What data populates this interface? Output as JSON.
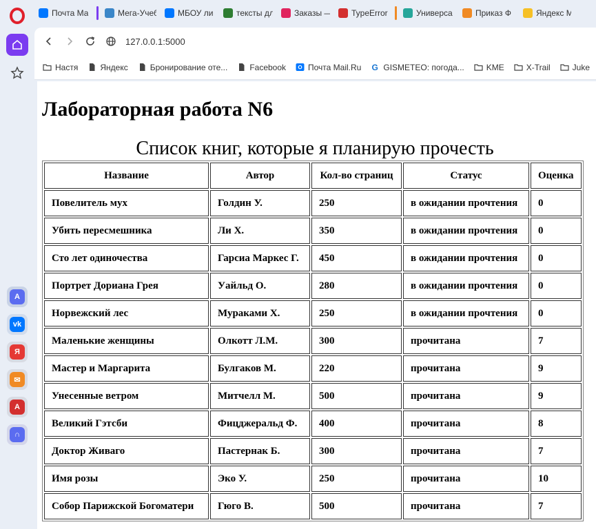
{
  "tabs": [
    {
      "title": "Почта Ма",
      "color": "#0077ff",
      "group": ""
    },
    {
      "title": "Мега-Учеб",
      "color": "#3a86c8",
      "group": "#7b3cf0"
    },
    {
      "title": "МБОУ ли",
      "color": "#0077ff",
      "group": ""
    },
    {
      "title": "тексты дл",
      "color": "#2e7d32",
      "group": ""
    },
    {
      "title": "Заказы —",
      "color": "#e0245e",
      "group": ""
    },
    {
      "title": "TypeError",
      "color": "#d32f2f",
      "group": ""
    },
    {
      "title": "Универса",
      "color": "#26a69a",
      "group": "#f08a24"
    },
    {
      "title": "Приказ Ф",
      "color": "#f08a24",
      "group": ""
    },
    {
      "title": "Яндекс М",
      "color": "#f6c026",
      "group": ""
    }
  ],
  "toolbar": {
    "back_icon": "back-arrow-icon",
    "forward_icon": "forward-arrow-icon",
    "reload_icon": "reload-icon",
    "url": "127.0.0.1:5000"
  },
  "bookmarks": [
    {
      "label": "Настя",
      "icon": "folder-icon"
    },
    {
      "label": "Яндекс",
      "icon": "page-icon"
    },
    {
      "label": "Бронирование оте...",
      "icon": "page-icon"
    },
    {
      "label": "Facebook",
      "icon": "page-icon"
    },
    {
      "label": "Почта Mail.Ru",
      "icon": "mail-icon"
    },
    {
      "label": "GISMETEO: погода...",
      "icon": "g-icon"
    },
    {
      "label": "KME",
      "icon": "folder-icon"
    },
    {
      "label": "X-Trail",
      "icon": "folder-icon"
    },
    {
      "label": "Juke",
      "icon": "folder-icon"
    }
  ],
  "page": {
    "heading": "Лабораторная работа N6",
    "caption": "Список книг, которые я планирую прочесть",
    "columns": [
      "Название",
      "Автор",
      "Кол-во страниц",
      "Статус",
      "Оценка"
    ],
    "rows": [
      [
        "Повелитель мух",
        "Голдин У.",
        "250",
        "в ожидании прочтения",
        "0"
      ],
      [
        "Убить пересмешника",
        "Ли Х.",
        "350",
        "в ожидании прочтения",
        "0"
      ],
      [
        "Сто лет одиночества",
        "Гарсиа Маркес Г.",
        "450",
        "в ожидании прочтения",
        "0"
      ],
      [
        "Портрет Дориана Грея",
        "Уайльд О.",
        "280",
        "в ожидании прочтения",
        "0"
      ],
      [
        "Норвежский лес",
        "Мураками Х.",
        "250",
        "в ожидании прочтения",
        "0"
      ],
      [
        "Маленькие женщины",
        "Олкотт Л.М.",
        "300",
        "прочитана",
        "7"
      ],
      [
        "Мастер и Маргарита",
        "Булгаков М.",
        "220",
        "прочитана",
        "9"
      ],
      [
        "Унесенные ветром",
        "Митчелл М.",
        "500",
        "прочитана",
        "9"
      ],
      [
        "Великий Гэтсби",
        "Фицджеральд Ф.",
        "400",
        "прочитана",
        "8"
      ],
      [
        "Доктор Живаго",
        "Пастернак Б.",
        "300",
        "прочитана",
        "7"
      ],
      [
        "Имя розы",
        "Эко У.",
        "250",
        "прочитана",
        "10"
      ],
      [
        "Собор Парижской Богоматери",
        "Гюго В.",
        "500",
        "прочитана",
        "7"
      ]
    ]
  },
  "sidebar": {
    "apps": [
      {
        "name": "aria-app-icon",
        "bg": "#c9d3e6",
        "fg": "#5b6cf0"
      },
      {
        "name": "vk-app-icon",
        "bg": "#d2dcec",
        "fg": "#0077ff"
      },
      {
        "name": "yandex-app-icon",
        "bg": "#d8dbe3",
        "fg": "#e53935"
      },
      {
        "name": "mail-app-icon",
        "bg": "#d8dbe3",
        "fg": "#f08a24"
      },
      {
        "name": "translate-app-icon",
        "bg": "#d8dbe3",
        "fg": "#d32f2f"
      },
      {
        "name": "music-app-icon",
        "bg": "#d4d6ea",
        "fg": "#5b6cf0"
      }
    ]
  }
}
